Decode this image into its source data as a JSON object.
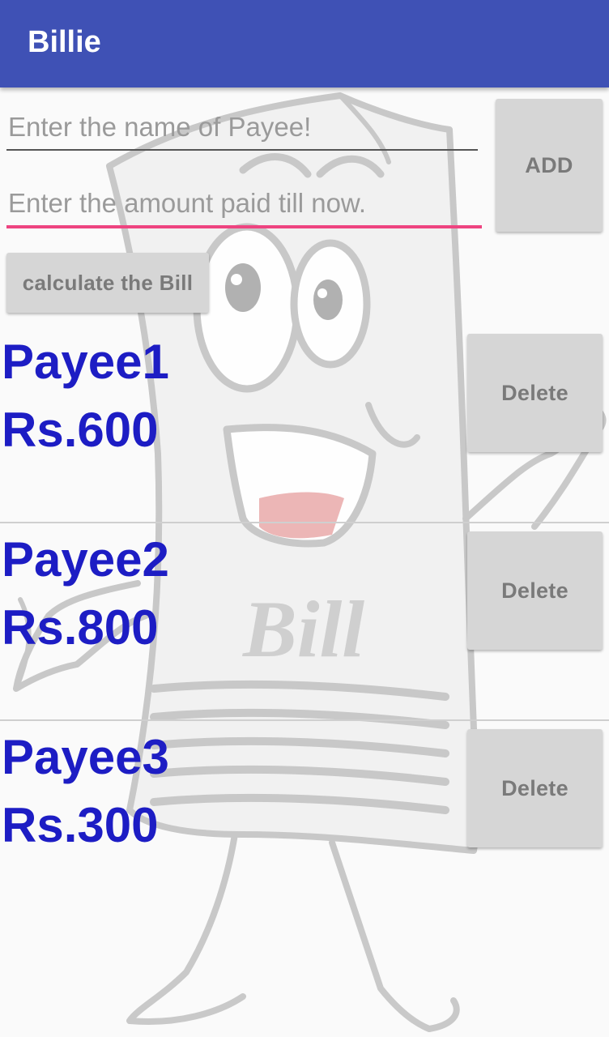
{
  "appbar": {
    "title": "Billie"
  },
  "form": {
    "name_placeholder": "Enter the name of Payee!",
    "amount_placeholder": "Enter the amount paid till now.",
    "add_label": "ADD",
    "calculate_label": "calculate the Bill"
  },
  "background": {
    "mascot_text": "Bill"
  },
  "payees": [
    {
      "name": "Payee1",
      "amount": "Rs.600",
      "delete_label": "Delete"
    },
    {
      "name": "Payee2",
      "amount": "Rs.800",
      "delete_label": "Delete"
    },
    {
      "name": "Payee3",
      "amount": "Rs.300",
      "delete_label": "Delete"
    }
  ],
  "colors": {
    "primary": "#3f51b5",
    "accent": "#ee4480",
    "payee_text": "#1d1dc4",
    "button_bg": "#d6d6d6"
  }
}
